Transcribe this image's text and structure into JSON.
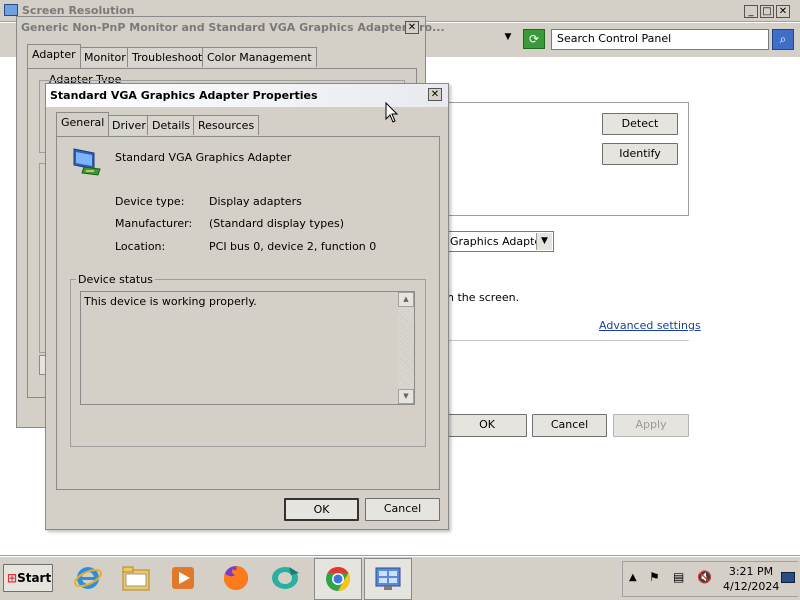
{
  "screen_resolution": {
    "title": "Screen Resolution",
    "search_placeholder": "Search Control Panel",
    "detect_label": "Detect",
    "identify_label": "Identify",
    "display_value": "Graphics Adapter",
    "partial_text": "n the screen.",
    "advanced_settings_label": "Advanced settings",
    "ok_label": "OK",
    "cancel_label": "Cancel",
    "apply_label": "Apply"
  },
  "monitor_dialog": {
    "title": "Generic Non-PnP Monitor and Standard VGA Graphics Adapter Pro...",
    "tabs": [
      "Adapter",
      "Monitor",
      "Troubleshoot",
      "Color Management"
    ],
    "adapter_type_label": "Adapter Type"
  },
  "adapter_dialog": {
    "title": "Standard VGA Graphics Adapter Properties",
    "tabs": [
      "General",
      "Driver",
      "Details",
      "Resources"
    ],
    "device_name": "Standard VGA Graphics Adapter",
    "device_type_label": "Device type:",
    "device_type_value": "Display adapters",
    "manufacturer_label": "Manufacturer:",
    "manufacturer_value": "(Standard display types)",
    "location_label": "Location:",
    "location_value": "PCI bus 0, device 2, function 0",
    "device_status_label": "Device status",
    "device_status_text": "This device is working properly.",
    "ok_label": "OK",
    "cancel_label": "Cancel"
  },
  "taskbar": {
    "start_label": "Start",
    "time": "3:21 PM",
    "date": "4/12/2024"
  }
}
